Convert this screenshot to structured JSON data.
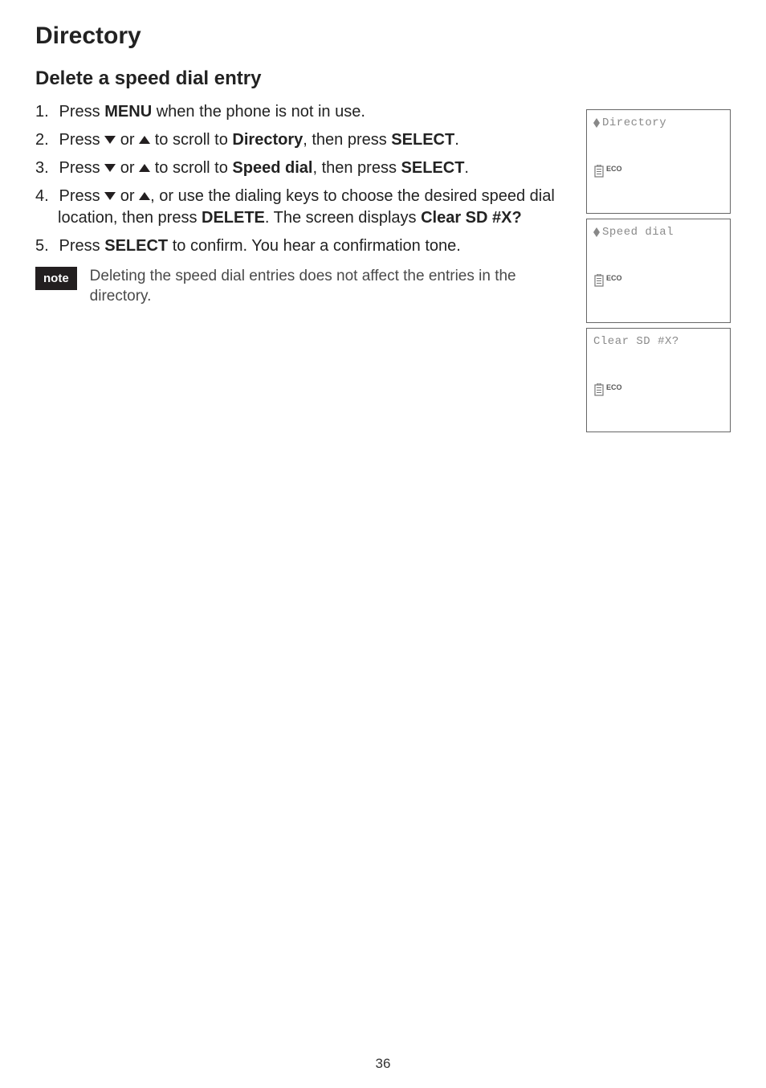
{
  "page_title": "Directory",
  "subtitle": "Delete a speed dial entry",
  "steps": [
    {
      "num": "1.",
      "parts": [
        {
          "t": "Press "
        },
        {
          "t": "MENU",
          "b": true
        },
        {
          "t": " when the phone is not in use."
        }
      ]
    },
    {
      "num": "2.",
      "parts": [
        {
          "t": "Press "
        },
        {
          "icon": "down"
        },
        {
          "t": " or "
        },
        {
          "icon": "up"
        },
        {
          "t": " to scroll to "
        },
        {
          "t": "Directory",
          "b": true
        },
        {
          "t": ", then press "
        },
        {
          "t": "SELECT",
          "b": true
        },
        {
          "t": "."
        }
      ]
    },
    {
      "num": "3.",
      "parts": [
        {
          "t": "Press "
        },
        {
          "icon": "down"
        },
        {
          "t": " or "
        },
        {
          "icon": "up"
        },
        {
          "t": " to scroll to "
        },
        {
          "t": "Speed dial",
          "b": true
        },
        {
          "t": ", then press "
        },
        {
          "t": "SELECT",
          "b": true
        },
        {
          "t": "."
        }
      ]
    },
    {
      "num": "4.",
      "parts": [
        {
          "t": "Press "
        },
        {
          "icon": "down"
        },
        {
          "t": " or "
        },
        {
          "icon": "up"
        },
        {
          "t": ", or use the dialing keys to choose the desired speed dial location, then press "
        },
        {
          "t": "DELETE",
          "b": true
        },
        {
          "t": ". The screen displays "
        },
        {
          "t": "Clear SD #X?",
          "b": true
        }
      ]
    },
    {
      "num": "5.",
      "parts": [
        {
          "t": "Press "
        },
        {
          "t": "SELECT",
          "b": true
        },
        {
          "t": " to confirm. You hear a confirmation tone."
        }
      ]
    }
  ],
  "note_label": "note",
  "note_text": "Deleting the speed dial entries does not affect the entries in the directory.",
  "screens": [
    {
      "line1": "Directory",
      "has_arrow": true,
      "eco": "ECO"
    },
    {
      "line1": "Speed dial",
      "has_arrow": true,
      "eco": "ECO"
    },
    {
      "line1": "Clear SD #X?",
      "has_arrow": false,
      "eco": "ECO"
    }
  ],
  "page_number": "36"
}
